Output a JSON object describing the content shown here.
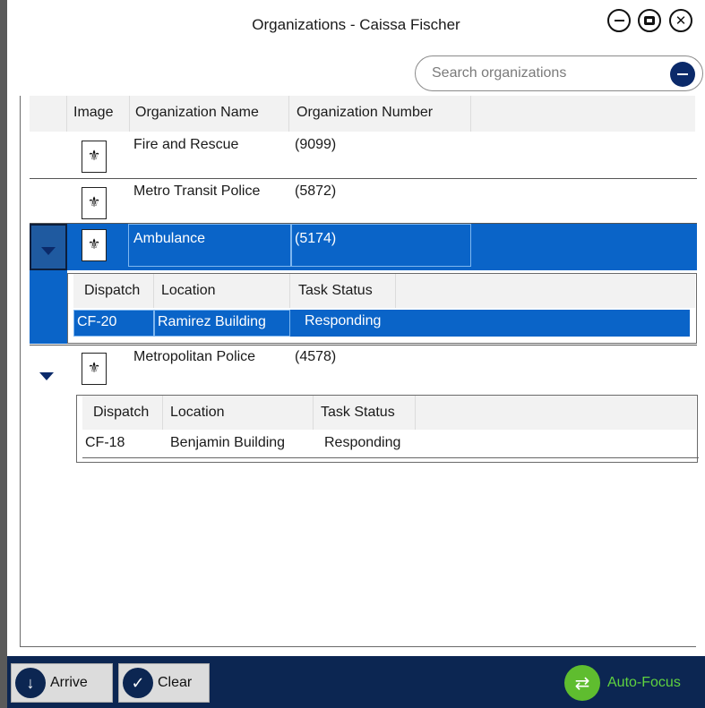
{
  "window": {
    "title": "Organizations - Caissa Fischer"
  },
  "search": {
    "placeholder": "Search organizations"
  },
  "grid": {
    "columns": [
      "Image",
      "Organization Name",
      "Organization Number"
    ],
    "rows": [
      {
        "name": "Fire and Rescue",
        "number": "(9099)",
        "icon": "organization-icon"
      },
      {
        "name": "Metro Transit Police",
        "number": "(5872)",
        "icon": "organization-icon"
      },
      {
        "name": "Ambulance",
        "number": "(5174)",
        "icon": "organization-icon",
        "selected": true,
        "expanded": true,
        "details": {
          "columns": [
            "Dispatch",
            "Location",
            "Task Status"
          ],
          "rows": [
            {
              "dispatch": "CF-20",
              "location": "Ramirez Building",
              "status": "Responding"
            }
          ]
        }
      },
      {
        "name": "Metropolitan Police",
        "number": "(4578)",
        "icon": "organization-icon",
        "expanded": true,
        "details": {
          "columns": [
            "Dispatch",
            "Location",
            "Task Status"
          ],
          "rows": [
            {
              "dispatch": "CF-18",
              "location": "Benjamin Building",
              "status": "Responding"
            }
          ]
        }
      }
    ]
  },
  "toolbar": {
    "arrive_label": "Arrive",
    "clear_label": "Clear",
    "autofocus_label": "Auto-Focus"
  },
  "colors": {
    "selection": "#0a64c8",
    "toolbar_bg": "#0c2652",
    "autofocus": "#5fd23f"
  }
}
